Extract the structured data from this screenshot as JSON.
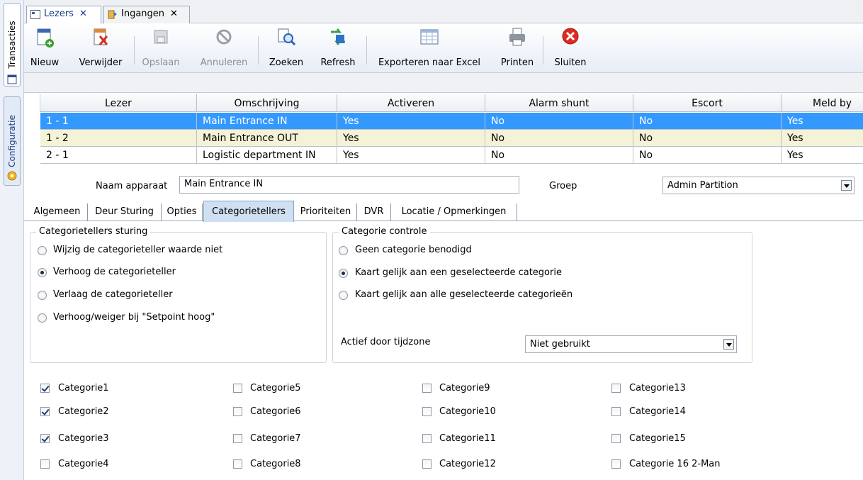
{
  "side_tabs": {
    "transacties": "Transacties",
    "configuratie": "Configuratie"
  },
  "doc_tabs": [
    {
      "label": "Lezers",
      "close": "✕"
    },
    {
      "label": "Ingangen",
      "close": "✕"
    }
  ],
  "toolbar": {
    "new": "Nieuw",
    "delete": "Verwijder",
    "save": "Opslaan",
    "cancel": "Annuleren",
    "search": "Zoeken",
    "refresh": "Refresh",
    "export": "Exporteren naar Excel",
    "print": "Printen",
    "close": "Sluiten"
  },
  "grid": {
    "columns": [
      "Lezer",
      "Omschrijving",
      "Activeren",
      "Alarm shunt",
      "Escort",
      "Meld by"
    ],
    "rows": [
      [
        "1 - 1",
        "Main Entrance IN",
        "Yes",
        "No",
        "No",
        "Yes"
      ],
      [
        "1 - 2",
        "Main Entrance OUT",
        "Yes",
        "No",
        "No",
        "Yes"
      ],
      [
        "2 - 1",
        "Logistic department IN",
        "Yes",
        "No",
        "No",
        "Yes"
      ]
    ],
    "selected_color": "#3399ff",
    "alt_row_color": "#f4f2d7"
  },
  "device": {
    "name_label": "Naam apparaat",
    "name_value": "Main Entrance IN",
    "group_label": "Groep",
    "group_value": "Admin Partition"
  },
  "tabs": [
    "Algemeen",
    "Deur Sturing",
    "Opties",
    "Categorietellers",
    "Prioriteiten",
    "DVR",
    "Locatie / Opmerkingen"
  ],
  "counter_control": {
    "title": "Categorietellers sturing",
    "options": [
      "Wijzig de categorieteller waarde niet",
      "Verhoog de categorieteller",
      "Verlaag de categorieteller",
      "Verhoog/weiger bij \"Setpoint hoog\""
    ],
    "selected": 1
  },
  "category_control": {
    "title": "Categorie controle",
    "options": [
      "Geen categorie benodigd",
      "Kaart gelijk aan een geselecteerde categorie",
      "Kaart gelijk aan alle geselecteerde categorieën"
    ],
    "selected": 1,
    "timezone_label": "Actief door tijdzone",
    "timezone_value": "Niet gebruikt"
  },
  "categories": [
    {
      "label": "Categorie1",
      "checked": true
    },
    {
      "label": "Categorie2",
      "checked": true
    },
    {
      "label": "Categorie3",
      "checked": true
    },
    {
      "label": "Categorie4",
      "checked": false
    },
    {
      "label": "Categorie5",
      "checked": false
    },
    {
      "label": "Categorie6",
      "checked": false
    },
    {
      "label": "Categorie7",
      "checked": false
    },
    {
      "label": "Categorie8",
      "checked": false
    },
    {
      "label": "Categorie9",
      "checked": false
    },
    {
      "label": "Categorie10",
      "checked": false
    },
    {
      "label": "Categorie11",
      "checked": false
    },
    {
      "label": "Categorie12",
      "checked": false
    },
    {
      "label": "Categorie13",
      "checked": false
    },
    {
      "label": "Categorie14",
      "checked": false
    },
    {
      "label": "Categorie15",
      "checked": false
    },
    {
      "label": "Categorie 16 2-Man",
      "checked": false
    }
  ]
}
